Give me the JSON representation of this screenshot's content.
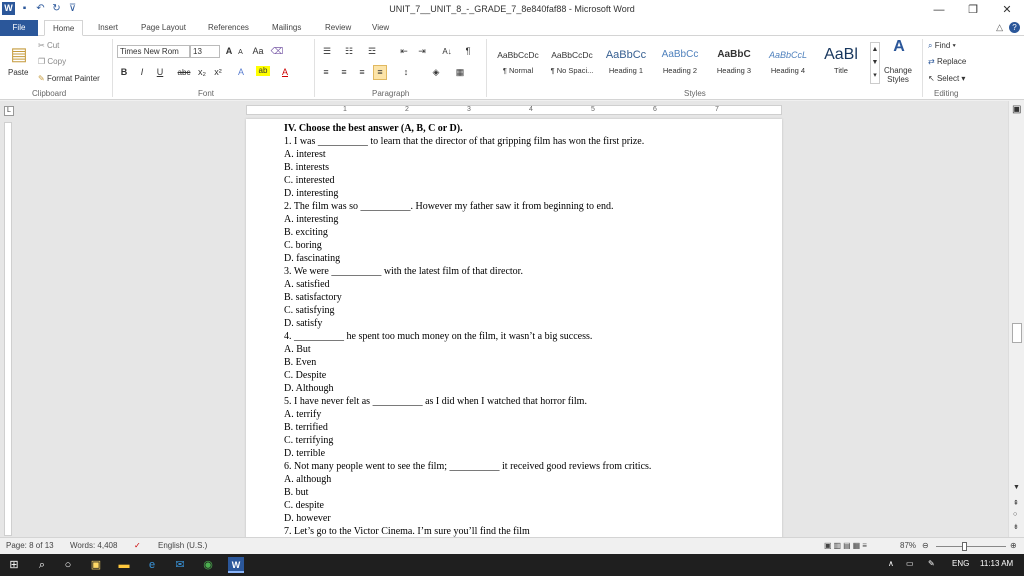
{
  "window": {
    "title": "UNIT_7__UNIT_8_-_GRADE_7_8e840faf88 - Microsoft Word",
    "minimize": "—",
    "restore": "❐",
    "close": "✕"
  },
  "tabs": [
    "File",
    "Home",
    "Insert",
    "Page Layout",
    "References",
    "Mailings",
    "Review",
    "View"
  ],
  "clipboard": {
    "paste": "Paste",
    "cut": "Cut",
    "copy": "Copy",
    "format_painter": "Format Painter",
    "label": "Clipboard"
  },
  "font": {
    "name": "Times New Rom",
    "size": "13",
    "grow": "A",
    "shrink": "A",
    "case": "Aa",
    "bold": "B",
    "italic": "I",
    "underline": "U",
    "strike": "abc",
    "sub": "x₂",
    "sup": "x²",
    "label": "Font"
  },
  "paragraph": {
    "label": "Paragraph",
    "pilcrow": "¶",
    "sort": "A↓"
  },
  "styles": {
    "label": "Styles",
    "items": [
      {
        "sample": "AaBbCcDc",
        "name": "¶ Normal"
      },
      {
        "sample": "AaBbCcDc",
        "name": "¶ No Spaci..."
      },
      {
        "sample": "AaBbCc",
        "name": "Heading 1"
      },
      {
        "sample": "AaBbCc",
        "name": "Heading 2"
      },
      {
        "sample": "AaBbC",
        "name": "Heading 3"
      },
      {
        "sample": "AaBbCcL",
        "name": "Heading 4"
      },
      {
        "sample": "AaBl",
        "name": "Title"
      }
    ],
    "change": "Change Styles"
  },
  "editing": {
    "find": "Find",
    "replace": "Replace",
    "select": "Select",
    "label": "Editing"
  },
  "ruler_numbers": [
    "1",
    "2",
    "3",
    "4",
    "5",
    "6",
    "7"
  ],
  "document": {
    "lines": [
      "IV. Choose the best answer (A, B, C or D).",
      "1. I was __________ to learn that the director of that gripping film has won the first prize.",
      "A. interest",
      "B. interests",
      "C. interested",
      "D. interesting",
      "2. The film was so __________. However my father saw it from beginning to end.",
      "A. interesting",
      "B. exciting",
      "C. boring",
      "D. fascinating",
      "3. We were __________ with the latest film of that director.",
      "A. satisfied",
      "B. satisfactory",
      "C. satisfying",
      "D. satisfy",
      "4. __________ he spent too much money on the film, it wasn’t a big success.",
      "A. But",
      "B. Even",
      "C. Despite",
      "D. Although",
      "5. I have never felt as __________ as I did when I watched that horror film.",
      "A. terrify",
      "B. terrified",
      "C. terrifying",
      "D. terrible",
      "6. Not many people went to see the film; __________ it received good reviews from critics.",
      "A. although",
      "B. but",
      "C. despite",
      "D. however",
      "7. Let’s go to the Victor Cinema. I’m sure you’ll find the film"
    ]
  },
  "status": {
    "page": "Page: 8 of 13",
    "words": "Words: 4,408",
    "language": "English (U.S.)",
    "zoom": "87%"
  },
  "taskbar": {
    "language": "ENG",
    "time": "11:13 AM"
  }
}
